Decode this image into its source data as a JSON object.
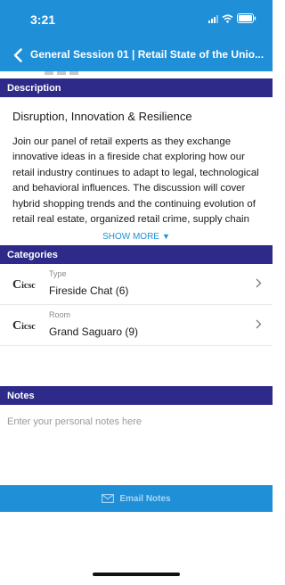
{
  "status_bar": {
    "time": "3:21"
  },
  "nav": {
    "title": "General Session 01 | Retail State of the Unio..."
  },
  "sections": {
    "description": "Description",
    "categories": "Categories",
    "notes": "Notes"
  },
  "event": {
    "title": "Disruption, Innovation & Resilience",
    "description": "Join our panel of retail experts as they exchange innovative ideas in a fireside chat exploring how our retail industry continues to adapt to legal, technological and behavioral influences. The discussion will cover hybrid shopping trends and the continuing evolution of retail real estate, organized retail crime, supply chain reinventions",
    "show_more": "SHOW MORE"
  },
  "categories": [
    {
      "logo": "icsc",
      "label": "Type",
      "value": "Fireside Chat (6)"
    },
    {
      "logo": "icsc",
      "label": "Room",
      "value": "Grand Saguaro (9)"
    }
  ],
  "notes": {
    "placeholder": "Enter your personal notes here"
  },
  "email_button": {
    "label": "Email Notes"
  },
  "icons": {
    "back": "chevron-left-icon",
    "row_chevron": "chevron-right-icon",
    "email": "envelope-icon",
    "signal": "cellular-signal-icon",
    "wifi": "wifi-icon",
    "battery": "battery-icon"
  },
  "colors": {
    "header_blue": "#1f8fd8",
    "section_purple": "#2d2a89",
    "link_blue": "#1f8fd8"
  }
}
